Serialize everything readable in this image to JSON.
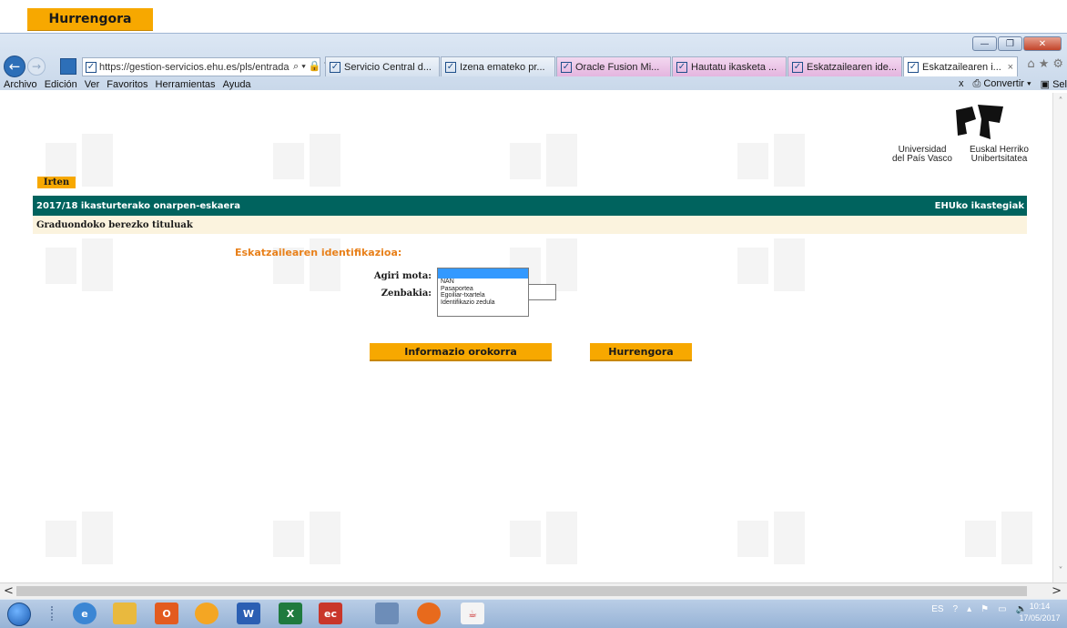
{
  "overlay": {
    "next_label": "Hurrengora"
  },
  "browser": {
    "address": "https://gestion-servicios.ehu.es/pls/entrada",
    "tabs": [
      {
        "label": "Servicio Central d..."
      },
      {
        "label": "Izena emateko pr..."
      },
      {
        "label": "Oracle Fusion Mi..."
      },
      {
        "label": "Hautatu ikasketa ..."
      },
      {
        "label": "Eskatzailearen ide..."
      },
      {
        "label": "Eskatzailearen i..."
      }
    ],
    "menu": [
      "Archivo",
      "Edición",
      "Ver",
      "Favoritos",
      "Herramientas",
      "Ayuda"
    ],
    "menu_right": {
      "close": "x",
      "convert": "Convertir",
      "select": "Sel"
    }
  },
  "page": {
    "logo": {
      "left": "Universidad del País Vasco",
      "left_line1": "Universidad",
      "left_line2": "del País Vasco",
      "right_line1": "Euskal Herriko",
      "right_line2": "Unibertsitatea"
    },
    "exit_label": "Irten",
    "header": {
      "title": "2017/18 ikasturterako onarpen-eskaera",
      "right": "EHUko ikastegiak"
    },
    "subheader": "Graduondoko berezko tituluak",
    "section_title": "Eskatzailearen identifikazioa:",
    "form": {
      "doc_type_label": "Agiri mota:",
      "number_label": "Zenbakia:",
      "doc_type_options": [
        "NAN",
        "Pasaportea",
        "Egoiliar-txartela",
        "Identifikazio zedula"
      ]
    },
    "buttons": {
      "info": "Informazio orokorra",
      "next": "Hurrengora"
    }
  },
  "taskbar": {
    "lang": "ES",
    "time": "10:14",
    "date": "17/05/2017"
  },
  "colors": {
    "orange": "#f7a800",
    "teal": "#00635e",
    "cream": "#fbf3de",
    "section": "#e8801a"
  }
}
